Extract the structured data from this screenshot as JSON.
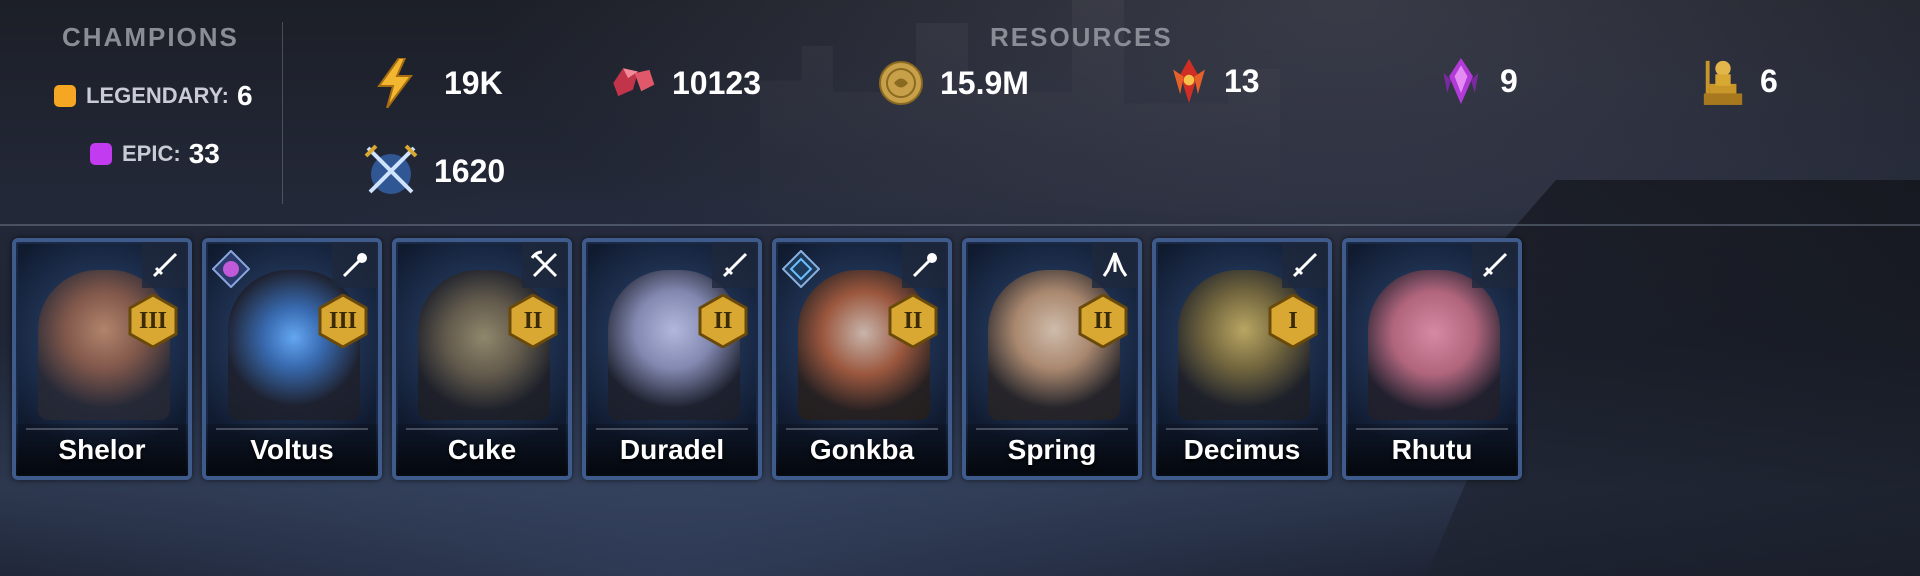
{
  "champions": {
    "title": "CHAMPIONS",
    "legendary": {
      "label": "LEGENDARY:",
      "count": "6",
      "color": "#f5a623"
    },
    "epic": {
      "label": "EPIC:",
      "count": "33",
      "color": "#c23bf0"
    }
  },
  "resources": {
    "title": "RESOURCES",
    "items": [
      {
        "icon": "energy-icon",
        "value": "19K"
      },
      {
        "icon": "ruby-gem-icon",
        "value": "10123"
      },
      {
        "icon": "silver-coin-icon",
        "value": "15.9M"
      },
      {
        "icon": "red-crystal-icon",
        "value": "13"
      },
      {
        "icon": "purple-crystal-icon",
        "value": "9"
      },
      {
        "icon": "gold-statue-icon",
        "value": "6"
      },
      {
        "icon": "crossed-swords-icon",
        "value": "1620"
      }
    ]
  },
  "cards": [
    {
      "name": "Shelor",
      "role": "sword-icon",
      "rank": "III",
      "affinity": null,
      "tint": "#8a5a48"
    },
    {
      "name": "Voltus",
      "role": "mace-icon",
      "rank": "III",
      "affinity": "magic-affinity-icon",
      "tint": "#3a6fb8"
    },
    {
      "name": "Cuke",
      "role": "axes-icon",
      "rank": "II",
      "affinity": null,
      "tint": "#6a5e4a"
    },
    {
      "name": "Duradel",
      "role": "sword-icon",
      "rank": "II",
      "affinity": null,
      "tint": "#8c90b8"
    },
    {
      "name": "Gonkba",
      "role": "mace-icon",
      "rank": "II",
      "affinity": "spirit-affinity-icon",
      "tint": "#a85a3a"
    },
    {
      "name": "Spring",
      "role": "praying-hands-icon",
      "rank": "II",
      "affinity": null,
      "tint": "#b89070"
    },
    {
      "name": "Decimus",
      "role": "sword-icon",
      "rank": "I",
      "affinity": null,
      "tint": "#7a6a3a"
    },
    {
      "name": "Rhutu",
      "role": "sword-icon",
      "rank": "",
      "affinity": null,
      "tint": "#c06a80"
    }
  ],
  "colors": {
    "card_border": "#3e5b8c",
    "rank_gold": "#d9a832"
  }
}
